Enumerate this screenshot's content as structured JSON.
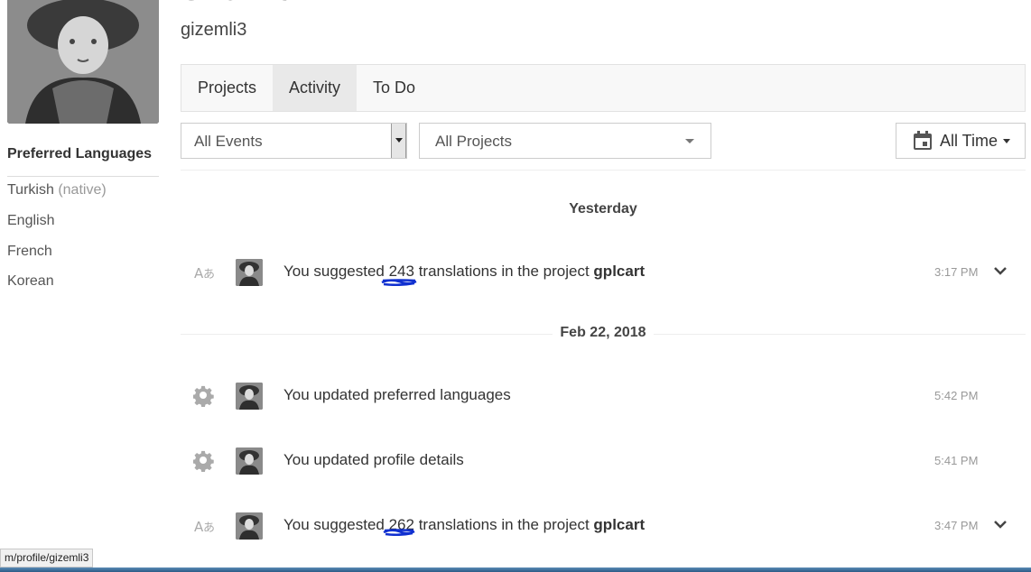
{
  "profile": {
    "name_partial": "Gizemli3",
    "username": "gizemli3"
  },
  "preferred_languages": {
    "title": "Preferred Languages",
    "items": [
      {
        "name": "Turkish",
        "note": "(native)"
      },
      {
        "name": "English",
        "note": ""
      },
      {
        "name": "French",
        "note": ""
      },
      {
        "name": "Korean",
        "note": ""
      }
    ]
  },
  "tabs": [
    {
      "label": "Projects",
      "active": false
    },
    {
      "label": "Activity",
      "active": true
    },
    {
      "label": "To Do",
      "active": false
    }
  ],
  "filters": {
    "events": "All Events",
    "projects": "All Projects",
    "time": "All Time"
  },
  "activity_groups": [
    {
      "date": "Yesterday",
      "items": [
        {
          "icon": "translate-icon",
          "prefix": "You suggested ",
          "count": "243",
          "suffix": " translations in the project ",
          "project": "gplcart",
          "time": "3:17 PM",
          "expandable": true
        }
      ]
    },
    {
      "date": "Feb 22, 2018",
      "items": [
        {
          "icon": "gear-icon",
          "prefix": "You updated preferred languages",
          "count": "",
          "suffix": "",
          "project": "",
          "time": "5:42 PM",
          "expandable": false
        },
        {
          "icon": "gear-icon",
          "prefix": "You updated profile details",
          "count": "",
          "suffix": "",
          "project": "",
          "time": "5:41 PM",
          "expandable": false
        },
        {
          "icon": "translate-icon",
          "prefix": "You suggested ",
          "count": "262",
          "suffix": " translations in the project ",
          "project": "gplcart",
          "time": "3:47 PM",
          "expandable": true
        }
      ]
    }
  ],
  "status_bar": {
    "url": "m/profile/gizemli3"
  },
  "colors": {
    "annotation": "#1030d0"
  }
}
